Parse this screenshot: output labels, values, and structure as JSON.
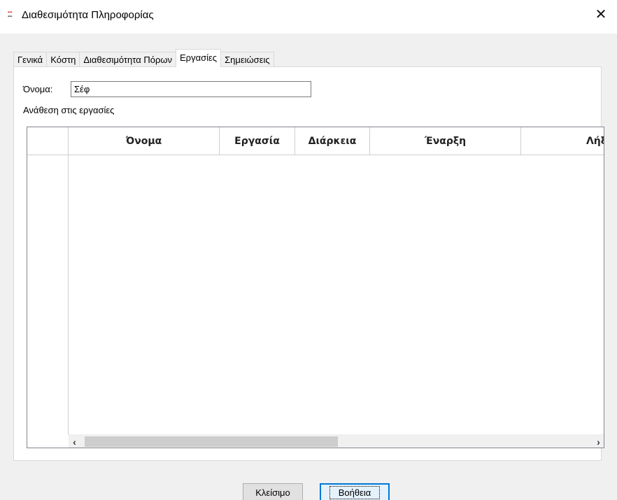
{
  "window": {
    "title": "Διαθεσιμότητα Πληροφορίας",
    "icon": "app-logo-icon",
    "close_glyph": "✕"
  },
  "tabs": [
    {
      "label": "Γενικά",
      "active": false
    },
    {
      "label": "Κόστη",
      "active": false
    },
    {
      "label": "Διαθεσιμότητα Πόρων",
      "active": false
    },
    {
      "label": "Εργασίες",
      "active": true
    },
    {
      "label": "Σημειώσεις",
      "active": false
    }
  ],
  "form": {
    "name_label": "Όνομα:",
    "name_value": "Σέφ",
    "assignments_label": "Ανάθεση στις εργασίες"
  },
  "grid": {
    "columns": [
      "Όνομα",
      "Εργασία",
      "Διάρκεια",
      "Έναρξη",
      "Λήξ"
    ],
    "rows": []
  },
  "footer": {
    "close_label": "Κλείσιμο",
    "help_label": "Βοήθεια"
  }
}
